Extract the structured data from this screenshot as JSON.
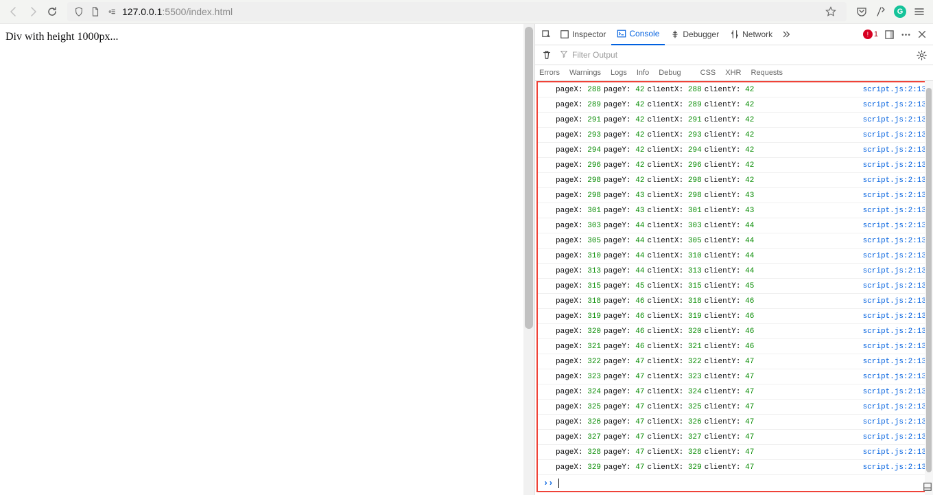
{
  "url": {
    "host": "127.0.0.1",
    "port": ":5500",
    "path": "/index.html"
  },
  "page": {
    "body_text": "Div with height 1000px..."
  },
  "devtools": {
    "tabs": {
      "inspector": "Inspector",
      "console": "Console",
      "debugger": "Debugger",
      "network": "Network"
    },
    "error_count": "1",
    "filter_placeholder": "Filter Output",
    "cats": [
      "Errors",
      "Warnings",
      "Logs",
      "Info",
      "Debug",
      "CSS",
      "XHR",
      "Requests"
    ],
    "source": "script.js:2:13",
    "labels": {
      "pageX": "pageX:",
      "pageY": "pageY:",
      "clientX": "clientX:",
      "clientY": "clientY:"
    },
    "logs": [
      {
        "px": "288",
        "py": "42",
        "cx": "288",
        "cy": "42"
      },
      {
        "px": "289",
        "py": "42",
        "cx": "289",
        "cy": "42"
      },
      {
        "px": "291",
        "py": "42",
        "cx": "291",
        "cy": "42"
      },
      {
        "px": "293",
        "py": "42",
        "cx": "293",
        "cy": "42"
      },
      {
        "px": "294",
        "py": "42",
        "cx": "294",
        "cy": "42"
      },
      {
        "px": "296",
        "py": "42",
        "cx": "296",
        "cy": "42"
      },
      {
        "px": "298",
        "py": "42",
        "cx": "298",
        "cy": "42"
      },
      {
        "px": "298",
        "py": "43",
        "cx": "298",
        "cy": "43"
      },
      {
        "px": "301",
        "py": "43",
        "cx": "301",
        "cy": "43"
      },
      {
        "px": "303",
        "py": "44",
        "cx": "303",
        "cy": "44"
      },
      {
        "px": "305",
        "py": "44",
        "cx": "305",
        "cy": "44"
      },
      {
        "px": "310",
        "py": "44",
        "cx": "310",
        "cy": "44"
      },
      {
        "px": "313",
        "py": "44",
        "cx": "313",
        "cy": "44"
      },
      {
        "px": "315",
        "py": "45",
        "cx": "315",
        "cy": "45"
      },
      {
        "px": "318",
        "py": "46",
        "cx": "318",
        "cy": "46"
      },
      {
        "px": "319",
        "py": "46",
        "cx": "319",
        "cy": "46"
      },
      {
        "px": "320",
        "py": "46",
        "cx": "320",
        "cy": "46"
      },
      {
        "px": "321",
        "py": "46",
        "cx": "321",
        "cy": "46"
      },
      {
        "px": "322",
        "py": "47",
        "cx": "322",
        "cy": "47"
      },
      {
        "px": "323",
        "py": "47",
        "cx": "323",
        "cy": "47"
      },
      {
        "px": "324",
        "py": "47",
        "cx": "324",
        "cy": "47"
      },
      {
        "px": "325",
        "py": "47",
        "cx": "325",
        "cy": "47"
      },
      {
        "px": "326",
        "py": "47",
        "cx": "326",
        "cy": "47"
      },
      {
        "px": "327",
        "py": "47",
        "cx": "327",
        "cy": "47"
      },
      {
        "px": "328",
        "py": "47",
        "cx": "328",
        "cy": "47"
      },
      {
        "px": "329",
        "py": "47",
        "cx": "329",
        "cy": "47"
      }
    ]
  }
}
